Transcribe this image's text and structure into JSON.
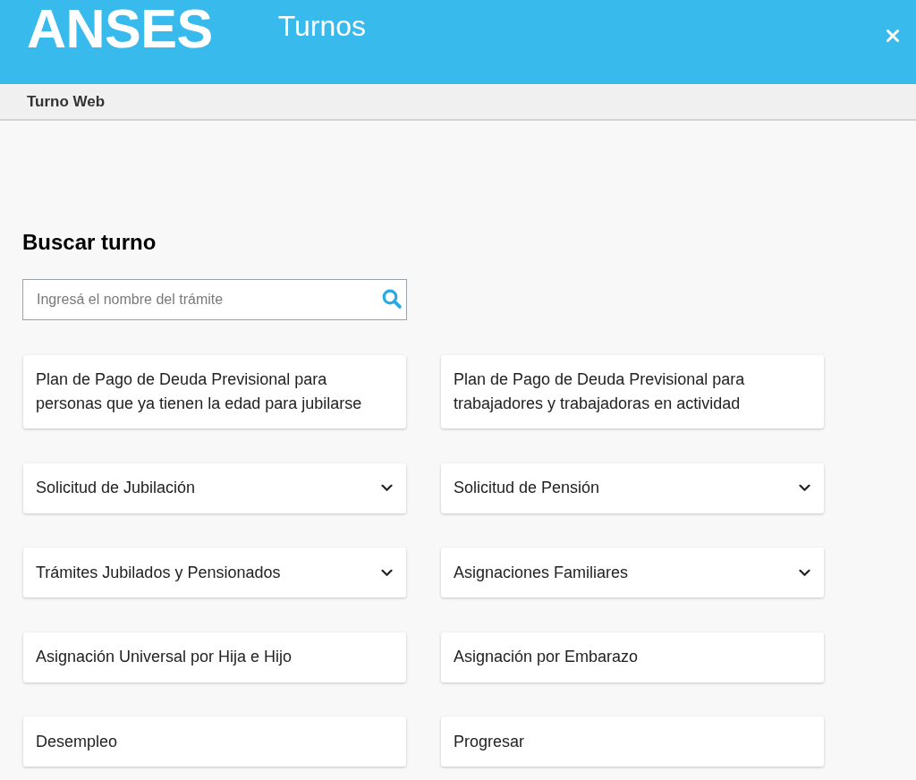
{
  "header": {
    "logo": "ANSES",
    "title": "Turnos"
  },
  "subheader": {
    "title": "Turno Web"
  },
  "search": {
    "heading": "Buscar turno",
    "placeholder": "Ingresá el nombre del trámite"
  },
  "procedures": [
    {
      "label": "Plan de Pago de Deuda Previsional para personas que ya tienen la edad para jubilarse",
      "kind": "link"
    },
    {
      "label": "Plan de Pago de Deuda Previsional para trabajadores y trabajadoras en actividad",
      "kind": "link"
    },
    {
      "label": "Solicitud de Jubilación",
      "kind": "dropdown"
    },
    {
      "label": "Solicitud de Pensión",
      "kind": "dropdown"
    },
    {
      "label": "Trámites Jubilados y Pensionados",
      "kind": "dropdown"
    },
    {
      "label": "Asignaciones Familiares",
      "kind": "dropdown"
    },
    {
      "label": "Asignación Universal por Hija e Hijo",
      "kind": "link"
    },
    {
      "label": "Asignación por Embarazo",
      "kind": "link"
    },
    {
      "label": "Desempleo",
      "kind": "link"
    },
    {
      "label": "Progresar",
      "kind": "link"
    }
  ]
}
